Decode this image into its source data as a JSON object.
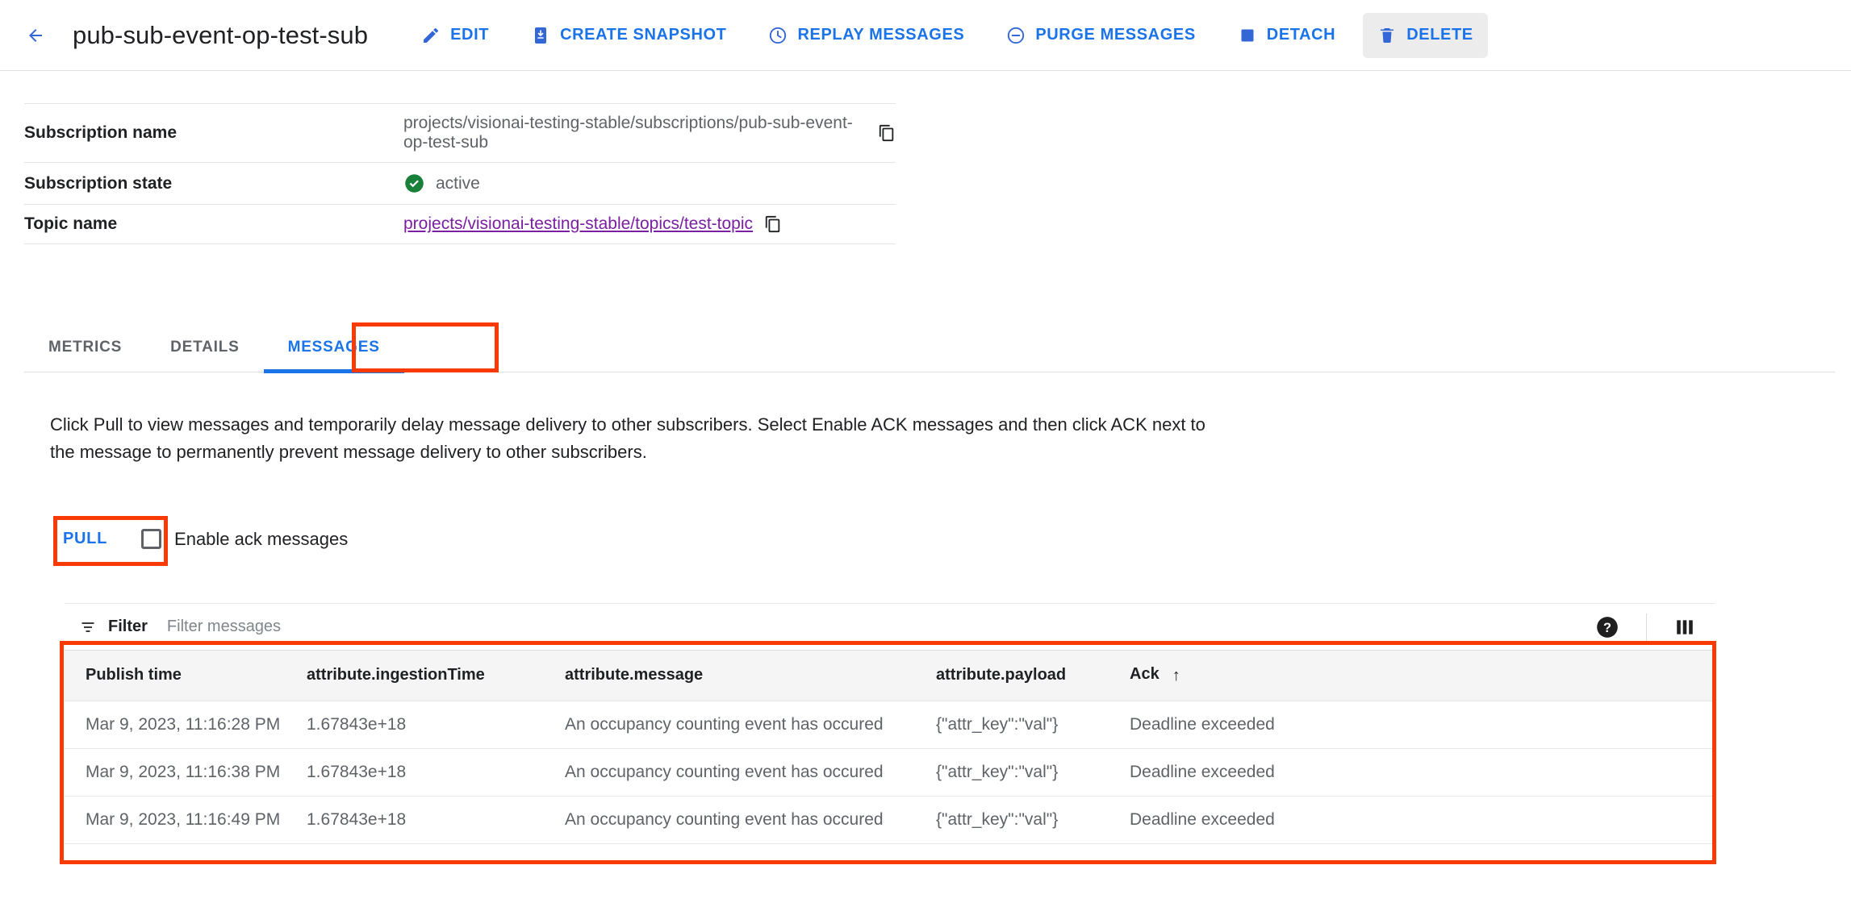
{
  "header": {
    "back_icon": "arrow-left-icon",
    "title": "pub-sub-event-op-test-sub",
    "actions": [
      {
        "label": "EDIT",
        "icon": "pencil-icon",
        "hovered": false
      },
      {
        "label": "CREATE SNAPSHOT",
        "icon": "snapshot-icon",
        "hovered": false
      },
      {
        "label": "REPLAY MESSAGES",
        "icon": "clock-icon",
        "hovered": false
      },
      {
        "label": "PURGE MESSAGES",
        "icon": "minus-circle-icon",
        "hovered": false
      },
      {
        "label": "DETACH",
        "icon": "square-icon",
        "hovered": false
      },
      {
        "label": "DELETE",
        "icon": "trash-icon",
        "hovered": true
      }
    ]
  },
  "info": {
    "rows": [
      {
        "key": "Subscription name",
        "value": "projects/visionai-testing-stable/subscriptions/pub-sub-event-op-test-sub",
        "type": "text-copy"
      },
      {
        "key": "Subscription state",
        "value": "active",
        "type": "status",
        "status_color": "#188038"
      },
      {
        "key": "Topic name",
        "value": "projects/visionai-testing-stable/topics/test-topic",
        "type": "link-copy",
        "link_color": "#7b1fa2"
      }
    ]
  },
  "tabs": {
    "items": [
      {
        "label": "METRICS",
        "active": false
      },
      {
        "label": "DETAILS",
        "active": false
      },
      {
        "label": "MESSAGES",
        "active": true
      }
    ],
    "active_color": "#1a73e8"
  },
  "main": {
    "description": "Click Pull to view messages and temporarily delay message delivery to other subscribers. Select Enable ACK messages and then click ACK next to the message to permanently prevent message delivery to other subscribers.",
    "pull_label": "PULL",
    "ack_checkbox_label": "Enable ack messages",
    "ack_checkbox_checked": false
  },
  "filter": {
    "icon": "filter-icon",
    "label": "Filter",
    "placeholder": "Filter messages",
    "value": "",
    "help_icon": "help-circle-icon",
    "columns_icon": "columns-icon"
  },
  "table": {
    "columns": [
      {
        "label": "Publish time",
        "sorted": false
      },
      {
        "label": "attribute.ingestionTime",
        "sorted": false
      },
      {
        "label": "attribute.message",
        "sorted": false
      },
      {
        "label": "attribute.payload",
        "sorted": false
      },
      {
        "label": "Ack",
        "sorted": true,
        "sort_direction": "asc",
        "sort_glyph": "↑"
      }
    ],
    "rows": [
      {
        "publish_time": "Mar 9, 2023, 11:16:28 PM",
        "ingestion_time": "1.67843e+18",
        "message": "An occupancy counting event has occured",
        "payload": "{\"attr_key\":\"val\"}",
        "ack": "Deadline exceeded"
      },
      {
        "publish_time": "Mar 9, 2023, 11:16:38 PM",
        "ingestion_time": "1.67843e+18",
        "message": "An occupancy counting event has occured",
        "payload": "{\"attr_key\":\"val\"}",
        "ack": "Deadline exceeded"
      },
      {
        "publish_time": "Mar 9, 2023, 11:16:49 PM",
        "ingestion_time": "1.67843e+18",
        "message": "An occupancy counting event has occured",
        "payload": "{\"attr_key\":\"val\"}",
        "ack": "Deadline exceeded"
      }
    ]
  },
  "annotations": {
    "color": "#f93a05",
    "boxes": [
      "messages-tab",
      "pull-button",
      "messages-table"
    ]
  }
}
